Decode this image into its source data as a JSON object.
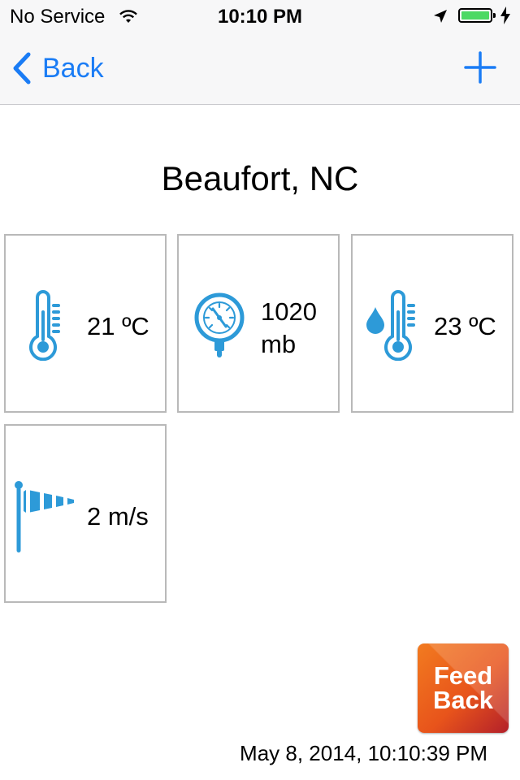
{
  "status_bar": {
    "carrier": "No Service",
    "time": "10:10 PM",
    "battery_color": "#4cd964"
  },
  "nav": {
    "back_label": "Back",
    "accent_color": "#1a7cf5",
    "add_icon": "plus-icon"
  },
  "location": "Beaufort, NC",
  "tiles": [
    {
      "icon": "thermometer-icon",
      "value": "21 ºC"
    },
    {
      "icon": "barometer-icon",
      "value_line1": "1020",
      "value_line2": "mb"
    },
    {
      "icon": "dewpoint-thermometer-icon",
      "value": "23 ºC"
    },
    {
      "icon": "windsock-icon",
      "value": "2 m/s"
    }
  ],
  "feedback_button": {
    "line1": "Feed",
    "line2": "Back"
  },
  "timestamp": "May 8, 2014, 10:10:39 PM"
}
